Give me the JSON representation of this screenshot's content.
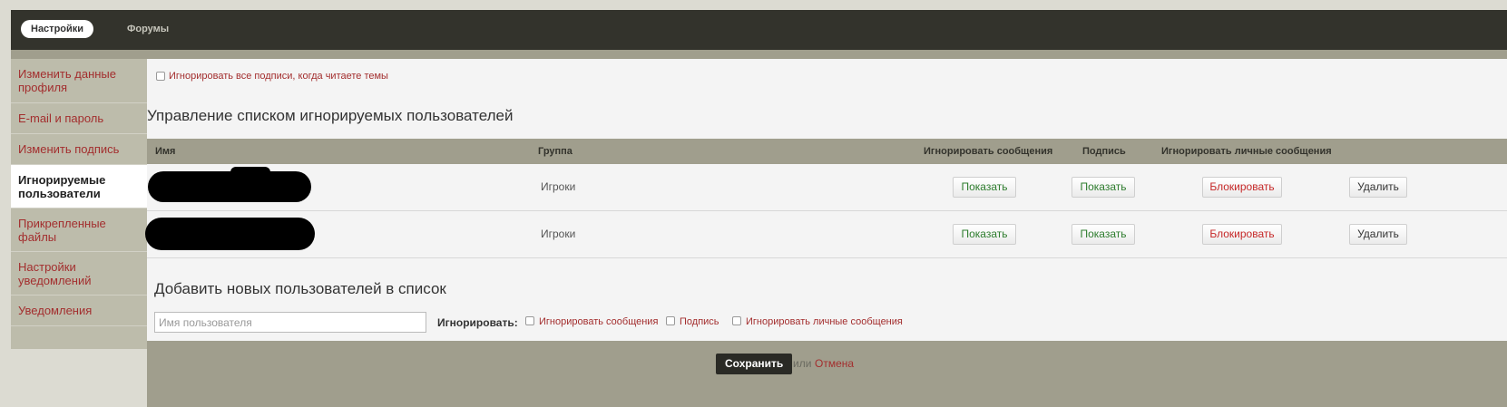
{
  "nav": {
    "tabs": [
      {
        "label": "Настройки",
        "active": true
      },
      {
        "label": "Форумы",
        "active": false
      }
    ]
  },
  "sidebar": {
    "items": [
      {
        "label": "Изменить данные профиля",
        "active": false
      },
      {
        "label": "E-mail и пароль",
        "active": false
      },
      {
        "label": "Изменить подпись",
        "active": false
      },
      {
        "label": "Игнорируемые пользователи",
        "active": true
      },
      {
        "label": "Прикрепленные файлы",
        "active": false
      },
      {
        "label": "Настройки уведомлений",
        "active": false
      },
      {
        "label": "Уведомления",
        "active": false
      }
    ]
  },
  "settings": {
    "ignore_signatures_label": "Игнорировать все подписи, когда читаете темы",
    "ignore_signatures_checked": false
  },
  "ignore_list": {
    "title": "Управление списком игнорируемых пользователей",
    "columns": [
      "Имя",
      "Группа",
      "Игнорировать сообщения",
      "Подпись",
      "Игнорировать личные сообщения"
    ],
    "rows": [
      {
        "name": "",
        "group": "Игроки",
        "messages_btn": "Показать",
        "signature_btn": "Показать",
        "pm_btn": "Блокировать",
        "delete_btn": "Удалить"
      },
      {
        "name": "",
        "group": "Игроки",
        "messages_btn": "Показать",
        "signature_btn": "Показать",
        "pm_btn": "Блокировать",
        "delete_btn": "Удалить"
      }
    ]
  },
  "add_users": {
    "title": "Добавить новых пользователей в список",
    "username_placeholder": "Имя пользователя",
    "username_value": "",
    "ignore_label": "Игнорировать:",
    "options": [
      {
        "label": "Игнорировать сообщения",
        "checked": false
      },
      {
        "label": "Подпись",
        "checked": false
      },
      {
        "label": "Игнорировать личные сообщения",
        "checked": false
      }
    ]
  },
  "form_actions": {
    "save_label": "Сохранить",
    "or_text": "или",
    "cancel_label": "Отмена"
  },
  "colors": {
    "topbar": "#33332c",
    "accent_bar": "#a09e8d",
    "link_red": "#a32e2e",
    "show_green": "#2e7d2e",
    "block_red": "#c62828"
  }
}
